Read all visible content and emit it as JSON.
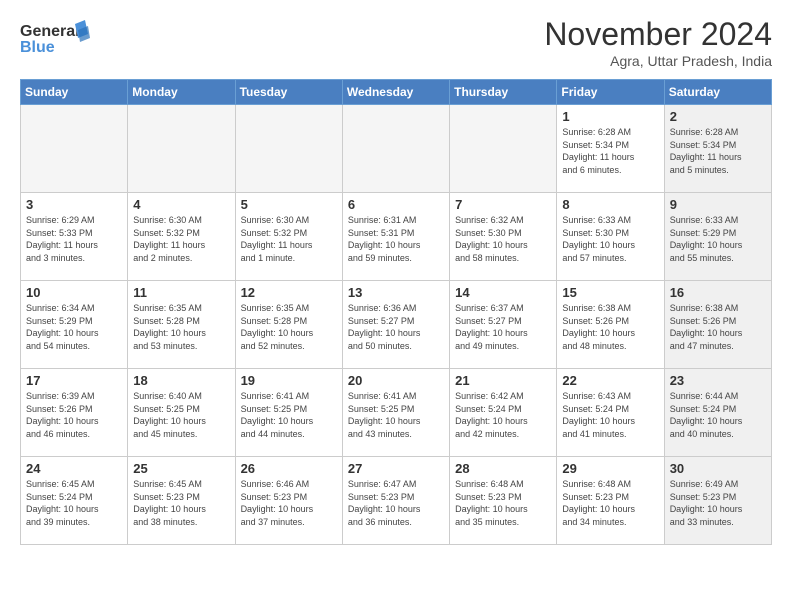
{
  "header": {
    "logo_line1": "General",
    "logo_line2": "Blue",
    "title": "November 2024",
    "location": "Agra, Uttar Pradesh, India"
  },
  "weekdays": [
    "Sunday",
    "Monday",
    "Tuesday",
    "Wednesday",
    "Thursday",
    "Friday",
    "Saturday"
  ],
  "weeks": [
    [
      {
        "day": "",
        "info": "",
        "empty": true
      },
      {
        "day": "",
        "info": "",
        "empty": true
      },
      {
        "day": "",
        "info": "",
        "empty": true
      },
      {
        "day": "",
        "info": "",
        "empty": true
      },
      {
        "day": "",
        "info": "",
        "empty": true
      },
      {
        "day": "1",
        "info": "Sunrise: 6:28 AM\nSunset: 5:34 PM\nDaylight: 11 hours\nand 6 minutes.",
        "shaded": false
      },
      {
        "day": "2",
        "info": "Sunrise: 6:28 AM\nSunset: 5:34 PM\nDaylight: 11 hours\nand 5 minutes.",
        "shaded": true
      }
    ],
    [
      {
        "day": "3",
        "info": "Sunrise: 6:29 AM\nSunset: 5:33 PM\nDaylight: 11 hours\nand 3 minutes.",
        "shaded": false
      },
      {
        "day": "4",
        "info": "Sunrise: 6:30 AM\nSunset: 5:32 PM\nDaylight: 11 hours\nand 2 minutes.",
        "shaded": false
      },
      {
        "day": "5",
        "info": "Sunrise: 6:30 AM\nSunset: 5:32 PM\nDaylight: 11 hours\nand 1 minute.",
        "shaded": false
      },
      {
        "day": "6",
        "info": "Sunrise: 6:31 AM\nSunset: 5:31 PM\nDaylight: 10 hours\nand 59 minutes.",
        "shaded": false
      },
      {
        "day": "7",
        "info": "Sunrise: 6:32 AM\nSunset: 5:30 PM\nDaylight: 10 hours\nand 58 minutes.",
        "shaded": false
      },
      {
        "day": "8",
        "info": "Sunrise: 6:33 AM\nSunset: 5:30 PM\nDaylight: 10 hours\nand 57 minutes.",
        "shaded": false
      },
      {
        "day": "9",
        "info": "Sunrise: 6:33 AM\nSunset: 5:29 PM\nDaylight: 10 hours\nand 55 minutes.",
        "shaded": true
      }
    ],
    [
      {
        "day": "10",
        "info": "Sunrise: 6:34 AM\nSunset: 5:29 PM\nDaylight: 10 hours\nand 54 minutes.",
        "shaded": false
      },
      {
        "day": "11",
        "info": "Sunrise: 6:35 AM\nSunset: 5:28 PM\nDaylight: 10 hours\nand 53 minutes.",
        "shaded": false
      },
      {
        "day": "12",
        "info": "Sunrise: 6:35 AM\nSunset: 5:28 PM\nDaylight: 10 hours\nand 52 minutes.",
        "shaded": false
      },
      {
        "day": "13",
        "info": "Sunrise: 6:36 AM\nSunset: 5:27 PM\nDaylight: 10 hours\nand 50 minutes.",
        "shaded": false
      },
      {
        "day": "14",
        "info": "Sunrise: 6:37 AM\nSunset: 5:27 PM\nDaylight: 10 hours\nand 49 minutes.",
        "shaded": false
      },
      {
        "day": "15",
        "info": "Sunrise: 6:38 AM\nSunset: 5:26 PM\nDaylight: 10 hours\nand 48 minutes.",
        "shaded": false
      },
      {
        "day": "16",
        "info": "Sunrise: 6:38 AM\nSunset: 5:26 PM\nDaylight: 10 hours\nand 47 minutes.",
        "shaded": true
      }
    ],
    [
      {
        "day": "17",
        "info": "Sunrise: 6:39 AM\nSunset: 5:26 PM\nDaylight: 10 hours\nand 46 minutes.",
        "shaded": false
      },
      {
        "day": "18",
        "info": "Sunrise: 6:40 AM\nSunset: 5:25 PM\nDaylight: 10 hours\nand 45 minutes.",
        "shaded": false
      },
      {
        "day": "19",
        "info": "Sunrise: 6:41 AM\nSunset: 5:25 PM\nDaylight: 10 hours\nand 44 minutes.",
        "shaded": false
      },
      {
        "day": "20",
        "info": "Sunrise: 6:41 AM\nSunset: 5:25 PM\nDaylight: 10 hours\nand 43 minutes.",
        "shaded": false
      },
      {
        "day": "21",
        "info": "Sunrise: 6:42 AM\nSunset: 5:24 PM\nDaylight: 10 hours\nand 42 minutes.",
        "shaded": false
      },
      {
        "day": "22",
        "info": "Sunrise: 6:43 AM\nSunset: 5:24 PM\nDaylight: 10 hours\nand 41 minutes.",
        "shaded": false
      },
      {
        "day": "23",
        "info": "Sunrise: 6:44 AM\nSunset: 5:24 PM\nDaylight: 10 hours\nand 40 minutes.",
        "shaded": true
      }
    ],
    [
      {
        "day": "24",
        "info": "Sunrise: 6:45 AM\nSunset: 5:24 PM\nDaylight: 10 hours\nand 39 minutes.",
        "shaded": false
      },
      {
        "day": "25",
        "info": "Sunrise: 6:45 AM\nSunset: 5:23 PM\nDaylight: 10 hours\nand 38 minutes.",
        "shaded": false
      },
      {
        "day": "26",
        "info": "Sunrise: 6:46 AM\nSunset: 5:23 PM\nDaylight: 10 hours\nand 37 minutes.",
        "shaded": false
      },
      {
        "day": "27",
        "info": "Sunrise: 6:47 AM\nSunset: 5:23 PM\nDaylight: 10 hours\nand 36 minutes.",
        "shaded": false
      },
      {
        "day": "28",
        "info": "Sunrise: 6:48 AM\nSunset: 5:23 PM\nDaylight: 10 hours\nand 35 minutes.",
        "shaded": false
      },
      {
        "day": "29",
        "info": "Sunrise: 6:48 AM\nSunset: 5:23 PM\nDaylight: 10 hours\nand 34 minutes.",
        "shaded": false
      },
      {
        "day": "30",
        "info": "Sunrise: 6:49 AM\nSunset: 5:23 PM\nDaylight: 10 hours\nand 33 minutes.",
        "shaded": true
      }
    ]
  ]
}
